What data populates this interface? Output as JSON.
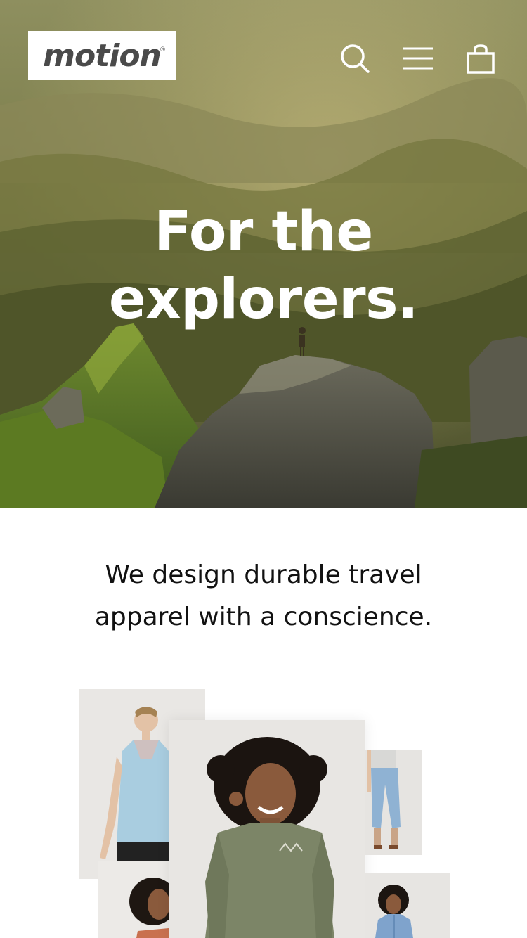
{
  "brand": {
    "logo_text": "motion",
    "logo_mark": "®"
  },
  "header": {
    "icons": [
      "search-icon",
      "menu-icon",
      "cart-icon"
    ]
  },
  "hero": {
    "title_line1": "For the",
    "title_line2": "explorers."
  },
  "intro": {
    "line1": "We design durable travel",
    "line2": "apparel with a conscience."
  },
  "colors": {
    "text_dark": "#111111",
    "logo_gray": "#4a4a4a",
    "hero_text": "#ffffff",
    "tile_bg": "#e9e7e4"
  }
}
